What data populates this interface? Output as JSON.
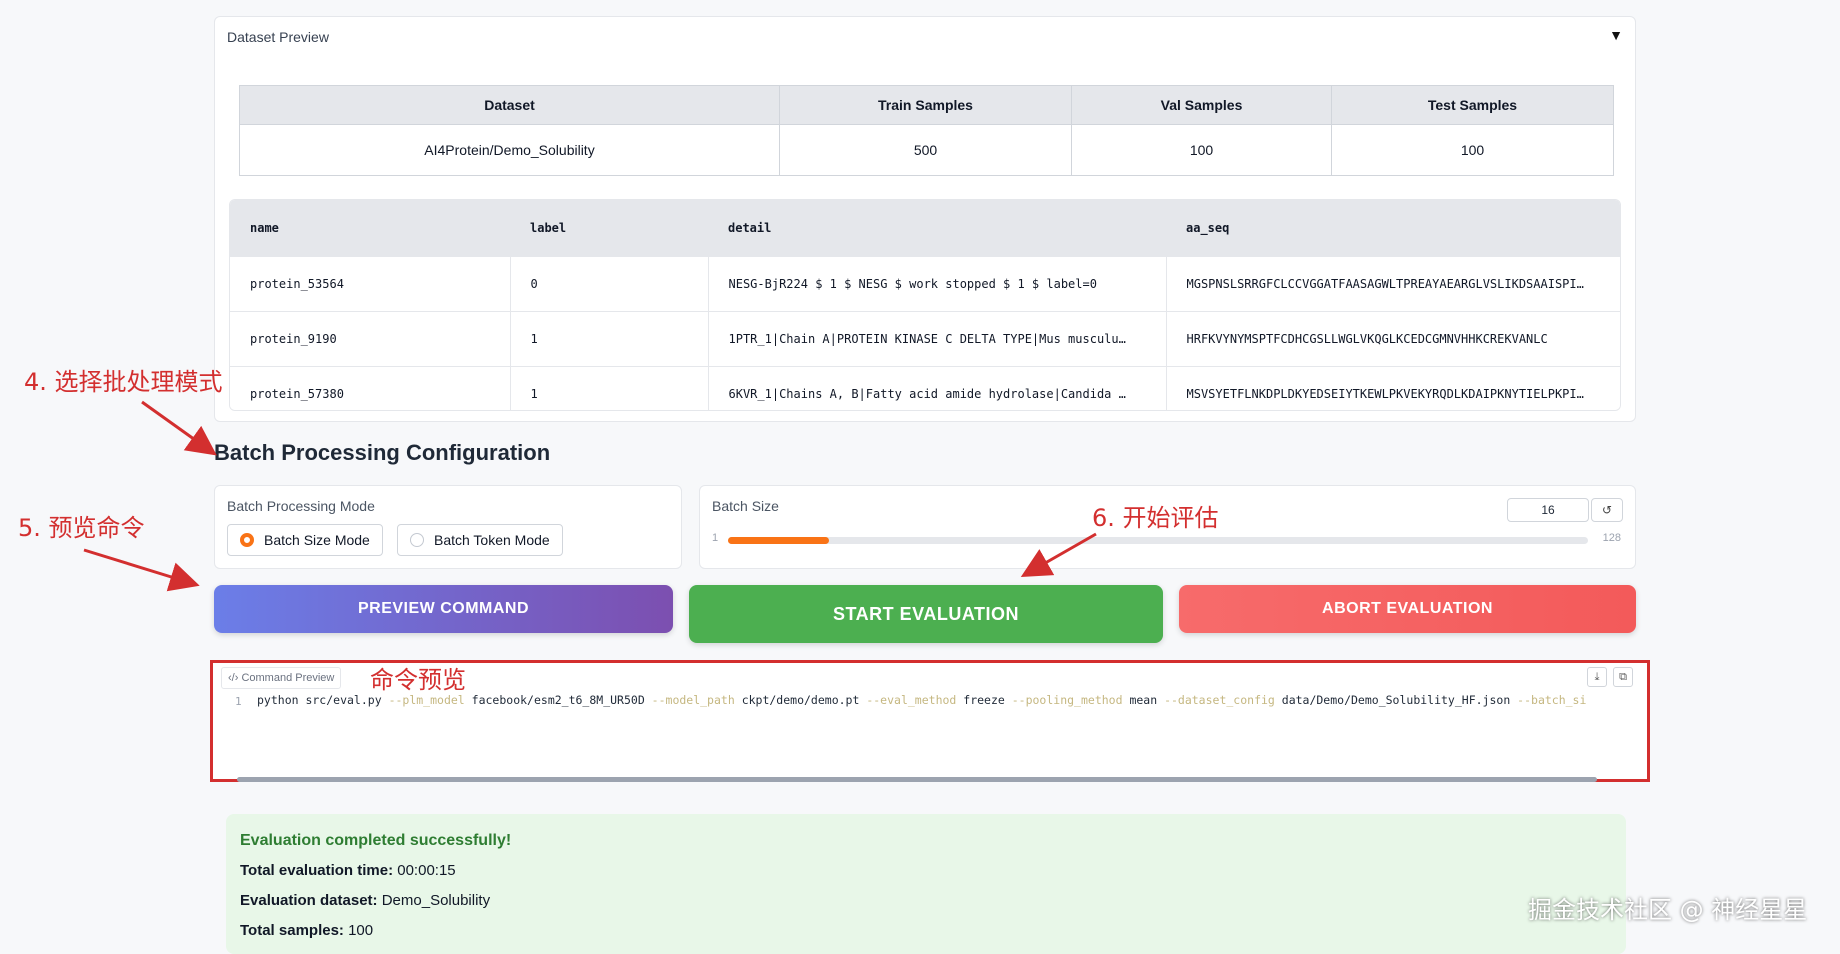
{
  "dataset_preview": {
    "title": "Dataset Preview",
    "toggle_icon": "▼",
    "summary": {
      "headers": [
        "Dataset",
        "Train Samples",
        "Val Samples",
        "Test Samples"
      ],
      "row": [
        "AI4Protein/Demo_Solubility",
        "500",
        "100",
        "100"
      ]
    },
    "samples": {
      "headers": [
        "name",
        "label",
        "detail",
        "aa_seq"
      ],
      "rows": [
        [
          "protein_53564",
          "0",
          "NESG-BjR224 $ 1 $ NESG $ work stopped $ 1 $ label=0",
          "MGSPNSLSRRGFCLCCVGGATFAASAGWLTPREAYAEARGLVSLIKDSAAISPI…"
        ],
        [
          "protein_9190",
          "1",
          "1PTR_1|Chain A|PROTEIN KINASE C DELTA TYPE|Mus musculu…",
          "HRFKVYNYMSPTFCDHCGSLLWGLVKQGLKCEDCGMNVHHKCREKVANLC"
        ],
        [
          "protein_57380",
          "1",
          "6KVR_1|Chains A, B|Fatty acid amide hydrolase|Candida …",
          "MSVSYETFLNKDPLDKYEDSEIYTKEWLPKVEKYRQDLKDAIPKNYTIELPKPI…"
        ]
      ]
    }
  },
  "batch_config": {
    "heading": "Batch Processing Configuration",
    "mode": {
      "label": "Batch Processing Mode",
      "options": [
        {
          "label": "Batch Size Mode",
          "selected": true
        },
        {
          "label": "Batch Token Mode",
          "selected": false
        }
      ]
    },
    "size": {
      "label": "Batch Size",
      "value": "16",
      "min": "1",
      "max": "128",
      "reset_icon": "↺",
      "fill_fraction": 0.118
    }
  },
  "actions": {
    "preview": "PREVIEW COMMAND",
    "start": "START EVALUATION",
    "abort": "ABORT EVALUATION"
  },
  "command_preview": {
    "tag_icon": "‹/›",
    "tag": "Command Preview",
    "line_number": "1",
    "tokens": [
      {
        "t": "python src/eval.py ",
        "flag": false
      },
      {
        "t": "--plm_model",
        "flag": true
      },
      {
        "t": " facebook/esm2_t6_8M_UR50D ",
        "flag": false
      },
      {
        "t": "--model_path",
        "flag": true
      },
      {
        "t": " ckpt/demo/demo.pt ",
        "flag": false
      },
      {
        "t": "--eval_method",
        "flag": true
      },
      {
        "t": " freeze ",
        "flag": false
      },
      {
        "t": "--pooling_method",
        "flag": true
      },
      {
        "t": " mean ",
        "flag": false
      },
      {
        "t": "--dataset_config",
        "flag": true
      },
      {
        "t": " data/Demo/Demo_Solubility_HF.json ",
        "flag": false
      },
      {
        "t": "--batch_si",
        "flag": true
      }
    ],
    "download_icon": "⤓",
    "copy_icon": "⧉"
  },
  "result": {
    "title": "Evaluation completed successfully!",
    "lines": [
      {
        "label": "Total evaluation time:",
        "value": " 00:00:15"
      },
      {
        "label": "Evaluation dataset:",
        "value": " Demo_Solubility"
      },
      {
        "label": "Total samples:",
        "value": " 100"
      }
    ]
  },
  "annotations": {
    "step4": "4. 选择批处理模式",
    "step5": "5. 预览命令",
    "step6": "6. 开始评估",
    "cmd": "命令预览",
    "watermark": "掘金技术社区 @ 神经星星"
  }
}
